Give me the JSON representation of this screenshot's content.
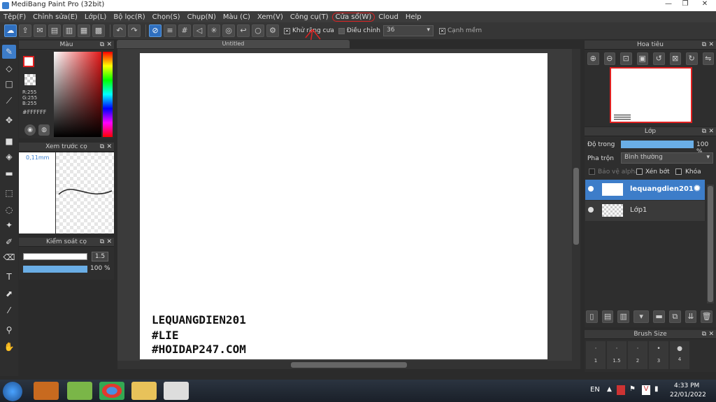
{
  "window": {
    "title": "MediBang Paint Pro (32bit)"
  },
  "menu": [
    "Tệp(F)",
    "Chỉnh sửa(E)",
    "Lớp(L)",
    "Bộ lọc(R)",
    "Chọn(S)",
    "Chụp(N)",
    "Màu (C)",
    "Xem(V)",
    "Công cụ(T)",
    "Cửa sổ(W)",
    "Cloud",
    "Help"
  ],
  "toolbar": {
    "antialias_label": "Khử răng cưa",
    "adjust_label": "Điều chỉnh",
    "adjust_value": "36",
    "edge_label": "Cạnh mềm"
  },
  "color_panel": {
    "title": "Màu",
    "r": "R:255",
    "g": "G:255",
    "b": "B:255",
    "hex": "#FFFFFF",
    "primary_color": "#e02020"
  },
  "brush_preview": {
    "title": "Xem trước cọ",
    "size": "0,11mm"
  },
  "brush_control": {
    "title": "Kiểm soát cọ",
    "size_value": "1.5",
    "opacity_value": "100 %"
  },
  "document": {
    "tab": "Untitled",
    "text_lines": [
      "LEQUANGDIEN201",
      "#LIE",
      "#HOIDAP247.COM"
    ]
  },
  "navigator": {
    "title": "Hoa tiêu"
  },
  "layers": {
    "title": "Lớp",
    "opacity_label": "Độ trong",
    "opacity_value": "100 %",
    "blend_label": "Pha trộn",
    "blend_value": "Bình thường",
    "protect_alpha": "Bảo vệ alpha",
    "clipping": "Xén bớt",
    "lock": "Khóa",
    "items": [
      {
        "name": "lequangdien201",
        "selected": true
      },
      {
        "name": "Lớp1",
        "selected": false
      }
    ]
  },
  "brush_size": {
    "title": "Brush Size",
    "sizes": [
      "1",
      "1.5",
      "2",
      "3",
      "4"
    ]
  },
  "taskbar": {
    "lang": "EN",
    "time": "4:33 PM",
    "date": "22/01/2022"
  }
}
